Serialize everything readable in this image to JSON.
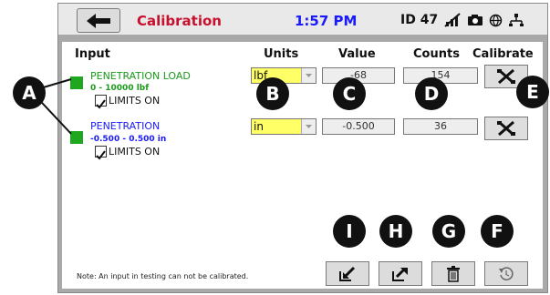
{
  "topbar": {
    "back_icon": "left-arrow-icon",
    "title": "Calibration",
    "time": "1:57 PM",
    "id_label": "ID 47",
    "status_icons": [
      "wifi-off-icon",
      "camera-icon",
      "globe-icon",
      "network-icon"
    ]
  },
  "table": {
    "headers": {
      "input": "Input",
      "units": "Units",
      "value": "Value",
      "counts": "Counts",
      "calibrate": "Calibrate"
    },
    "rows": [
      {
        "name": "PENETRATION LOAD",
        "range": "0 - 10000 lbf",
        "limits_label": "LIMITS ON",
        "limits_checked": true,
        "unit": "lbf",
        "value": "-68",
        "counts": "154",
        "name_color": "#1a9a1a"
      },
      {
        "name": "PENETRATION",
        "range": "-0.500 - 0.500 in",
        "limits_label": "LIMITS ON",
        "limits_checked": true,
        "unit": "in",
        "value": "-0.500",
        "counts": "36",
        "name_color": "#1a1aff"
      }
    ]
  },
  "note": "Note:  An input in testing can not be calibrated.",
  "bottom_buttons": [
    {
      "icon": "import-icon"
    },
    {
      "icon": "export-icon"
    },
    {
      "icon": "trash-icon"
    },
    {
      "icon": "reset-icon"
    }
  ],
  "callouts": {
    "a": "A",
    "b": "B",
    "c": "C",
    "d": "D",
    "e": "E",
    "f": "F",
    "g": "G",
    "h": "H",
    "i": "I"
  },
  "colors": {
    "swatch_green": "#1fa81f",
    "title_red": "#c8102e",
    "time_blue": "#1a1aff",
    "unit_yellow": "#ffff66"
  }
}
